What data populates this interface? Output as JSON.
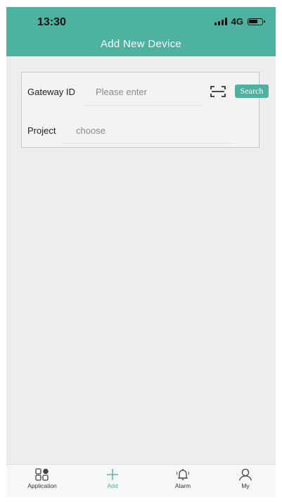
{
  "status_bar": {
    "time": "13:30",
    "network": "4G"
  },
  "header": {
    "title": "Add New Device"
  },
  "form": {
    "gateway": {
      "label": "Gateway ID",
      "placeholder": "Please enter"
    },
    "search_label": "Search",
    "project": {
      "label": "Project",
      "placeholder": "choose"
    }
  },
  "tabbar": {
    "items": [
      {
        "label": "Application",
        "icon": "grid-icon"
      },
      {
        "label": "Add",
        "icon": "plus-icon",
        "active": true
      },
      {
        "label": "Alarm",
        "icon": "bell-icon"
      },
      {
        "label": "My",
        "icon": "user-icon"
      }
    ]
  },
  "colors": {
    "accent": "#4db3a0",
    "background": "#ededed"
  }
}
